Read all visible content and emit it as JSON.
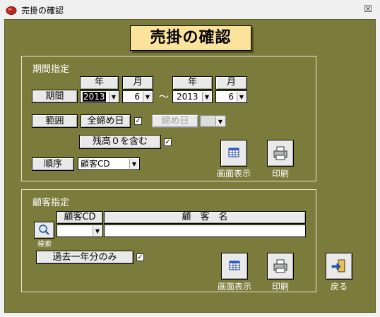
{
  "window": {
    "title": "売掛の確認",
    "close_glyph": "☒"
  },
  "header": {
    "title": "売掛の確認"
  },
  "period": {
    "group_label": "期間指定",
    "year_label": "年",
    "month_label": "月",
    "period_button": "期間",
    "from_year": "2013",
    "from_month": "6",
    "separator": "〜",
    "to_year": "2013",
    "to_month": "6",
    "range_button": "範囲",
    "all_closing_button": "全締め日",
    "all_closing_checked": "✓",
    "closing_day_button": "締め日",
    "closing_day_value": "",
    "balance_zero_button": "残高０を含む",
    "balance_zero_checked": "✓",
    "order_button": "順序",
    "order_value": "顧客CD",
    "display_caption": "画面表示",
    "print_caption": "印刷"
  },
  "customer": {
    "group_label": "顧客指定",
    "cd_header": "顧客CD",
    "name_header": "顧　客　名",
    "cd_value": "",
    "name_value": "",
    "search_caption": "検索",
    "past_year_button": "過去一年分のみ",
    "past_year_checked": "✓",
    "display_caption": "画面表示",
    "print_caption": "印刷"
  },
  "footer": {
    "back_caption": "戻る"
  },
  "icons": {
    "app": "app-icon",
    "close": "close-icon",
    "display": "screen-display-icon",
    "print": "printer-icon",
    "search": "magnifier-icon",
    "back": "exit-door-icon"
  },
  "colors": {
    "background": "#7b7c3c",
    "title_box": "#fbe39c"
  }
}
